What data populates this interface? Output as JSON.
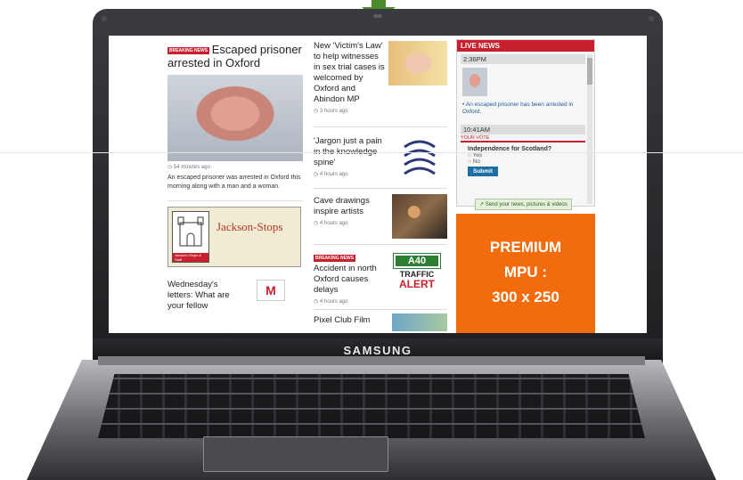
{
  "device": {
    "brand": "SAMSUNG"
  },
  "colors": {
    "accent_red": "#c8202c",
    "mpu_orange": "#f26b0c",
    "arrow_green": "#4a8a2a"
  },
  "col1": {
    "badge": "BREAKING NEWS",
    "headline": "Escaped prisoner arrested in Oxford",
    "time": "54 minutes ago",
    "summary": "An escaped prisoner was arrested in Oxford this morning along with a man and a woman.",
    "ad_name": "Jackson-Stops",
    "ad_crest_text": "Jackson-Stops & Staff",
    "letters_headline": "Wednesday's letters: What are your fellow",
    "letters_icon": "M"
  },
  "col2": {
    "story1": {
      "headline": "New 'Victim's Law' to help witnesses in sex trial cases is welcomed by Oxford and Abindon MP",
      "time": "3 hours ago"
    },
    "story2": {
      "headline": "'Jargon just a pain in the knowledge spine'",
      "time": "4 hours ago"
    },
    "story3": {
      "headline": "Cave drawings inspire artists",
      "time": "4 hours ago"
    },
    "story4": {
      "badge": "BREAKING NEWS",
      "headline": "Accident in north Oxford causes delays",
      "time": "4 hours ago",
      "road": "A40",
      "alert1": "TRAFFIC",
      "alert2": "ALERT"
    },
    "story5": {
      "headline": "Pixel Club Film"
    }
  },
  "col3": {
    "live_title": "LIVE NEWS",
    "entry1_time": "2:36PM",
    "entry1_text": "An escaped prisoner has been arrested in Oxford.",
    "entry2_time": "10:41AM",
    "vote_label": "YOUR VOTE",
    "question": "Independence for Scotland?",
    "option_yes": "Yes",
    "option_no": "No",
    "submit": "Submit",
    "send": "Send your news, pictures & videos",
    "mpu_line1": "PREMIUM",
    "mpu_line2": "MPU :",
    "mpu_line3": "300 x 250"
  }
}
